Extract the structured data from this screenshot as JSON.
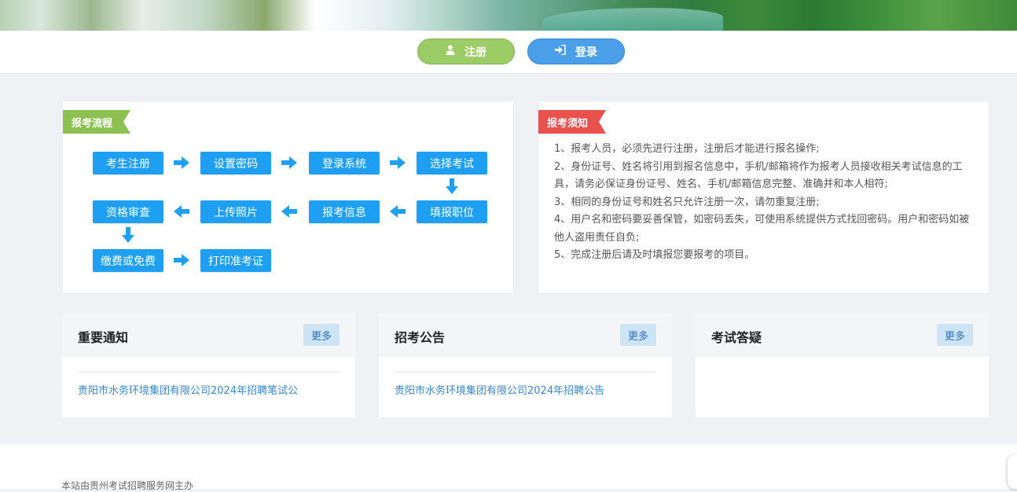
{
  "header": {
    "register_label": "注册",
    "login_label": "登录"
  },
  "flow": {
    "title": "报考流程",
    "steps": {
      "s1": "考生注册",
      "s2": "设置密码",
      "s3": "登录系统",
      "s4": "选择考试",
      "s5": "填报职位",
      "s6": "报考信息",
      "s7": "上传照片",
      "s8": "资格审查",
      "s9": "缴费或免费",
      "s10": "打印准考证"
    }
  },
  "notice": {
    "title": "报考须知",
    "lines": [
      "1、报考人员，必须先进行注册，注册后才能进行报名操作;",
      "2、身份证号、姓名将引用到报名信息中，手机/邮箱将作为报考人员接收相关考试信息的工具，请务必保证身份证号、姓名、手机/邮箱信息完整、准确并和本人相符;",
      "3、相同的身份证号和姓名只允许注册一次，请勿重复注册;",
      "4、用户名和密码要妥善保管，如密码丢失，可使用系统提供方式找回密码。用户和密码如被他人盗用责任自负;",
      "5、完成注册后请及时填报您要报考的项目。"
    ]
  },
  "cards": [
    {
      "title": "重要通知",
      "more": "更多",
      "items": [
        "贵阳市水务环境集团有限公司2024年招聘笔试公"
      ]
    },
    {
      "title": "招考公告",
      "more": "更多",
      "items": [
        "贵阳市水务环境集团有限公司2024年招聘公告"
      ]
    },
    {
      "title": "考试答疑",
      "more": "更多",
      "items": []
    }
  ],
  "footer": {
    "text": "本站由贵州考试招聘服务网主办"
  },
  "colors": {
    "register": "#9ccc65",
    "login": "#4a9fe8",
    "step": "#1e9ff2",
    "ribbon_green": "#8cc152",
    "ribbon_red": "#e9514d",
    "link": "#3a86c9"
  },
  "icons": {
    "register": "user-icon",
    "login": "sign-in-icon"
  }
}
